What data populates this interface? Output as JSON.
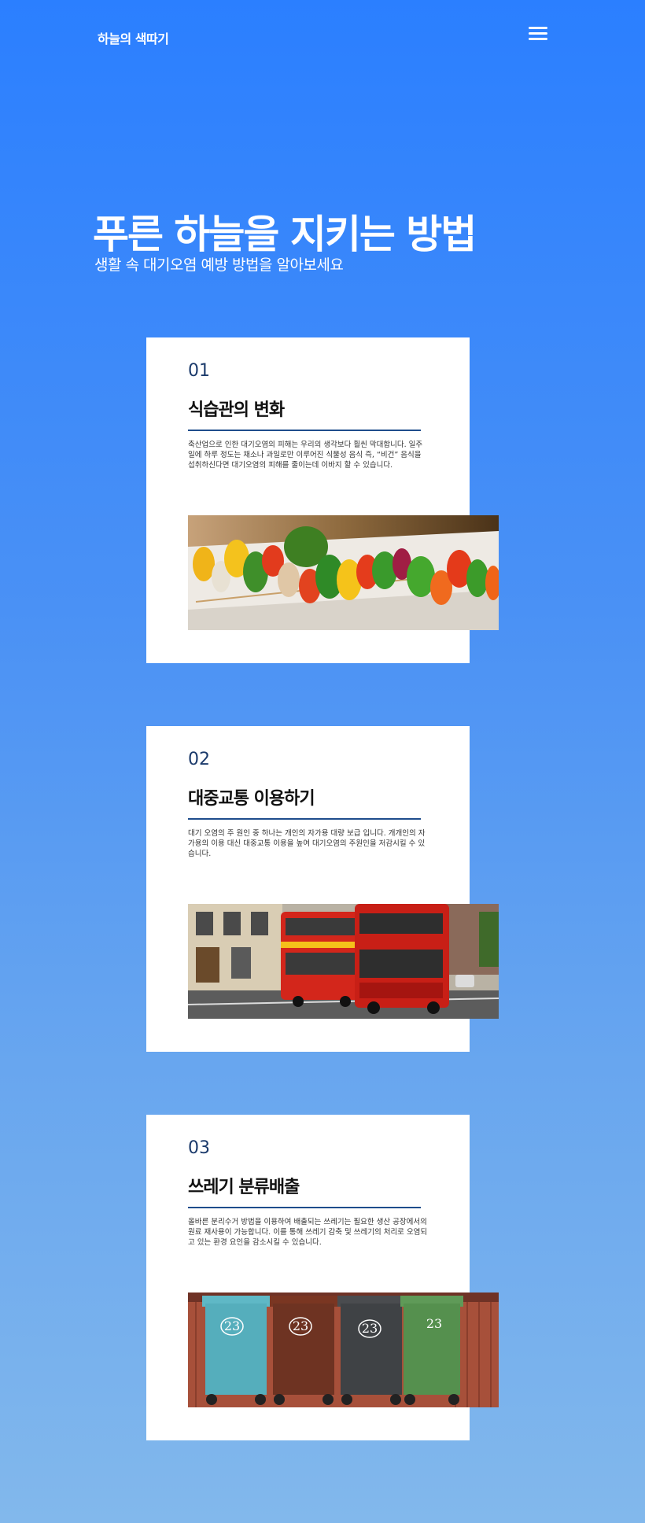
{
  "header": {
    "brand": "하늘의 색따기",
    "menu_icon": "hamburger-menu-icon"
  },
  "hero": {
    "title": "푸른 하늘을 지키는 방법",
    "subtitle": "생활 속 대기오염 예방 방법을 알아보세요"
  },
  "cards": [
    {
      "number": "01",
      "title": "식습관의 변화",
      "text": " 축산업으로 인한 대기오염의 피해는 우리의 생각보다 훨씬 막대합니다. 일주일에 하루 정도는 채소나 과일로만 이루어진 식물성 음식 즉, “비건” 음식을 섭취하신다면 대기오염의 피해를 줄이는데 이바지 할 수 있습니다.",
      "image": "vegetable-skewers-photo"
    },
    {
      "number": "02",
      "title": "대중교통 이용하기",
      "text": " 대기 오염의 주 원인 중 하나는 개인의 자가용 대량 보급 입니다. 개개인의 자가용의 이용 대신 대중교통 이용을 높여 대기오염의 주원인을 저감시킬 수 있습니다.",
      "image": "red-double-decker-buses-photo"
    },
    {
      "number": "03",
      "title": "쓰레기 분류배출",
      "text": " 올바른 분리수거 방법을 이용하여 배출되는 쓰레기는 필요한 생산 공장에서의 원료 재사용이 가능합니다. 이를 통해 쓰레기 감축 및 쓰레기의 처리로 오염되고 있는 환경 요인을 감소시킬 수 있습니다.",
      "image": "recycling-bins-photo",
      "bin_label": "23"
    }
  ]
}
